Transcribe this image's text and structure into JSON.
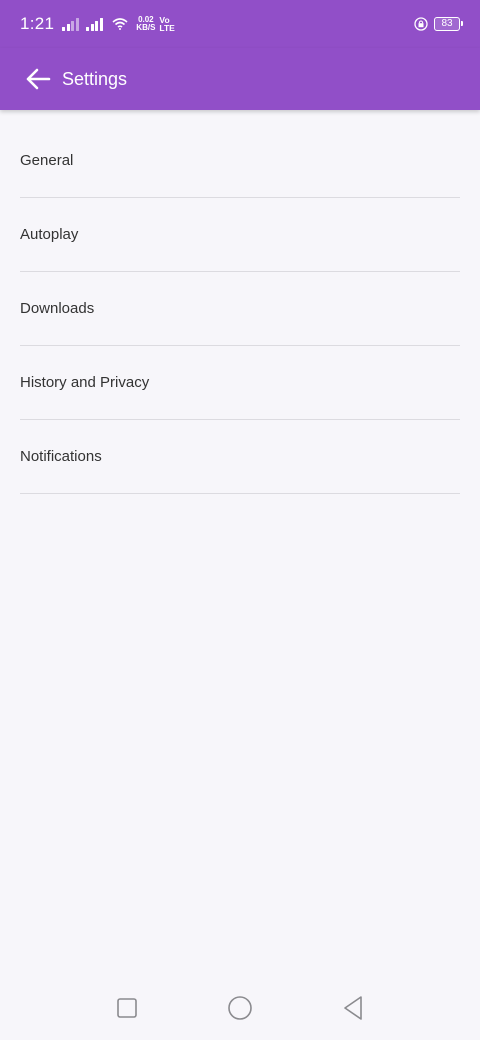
{
  "status_bar": {
    "time": "1:21",
    "speed_value": "0.02",
    "speed_unit": "KB/S",
    "volte_top": "Vo",
    "volte_bottom": "LTE",
    "battery": "83",
    "icons": [
      "signal-icon",
      "signal-icon",
      "wifi-icon",
      "lock-rotation-icon",
      "battery-icon"
    ]
  },
  "app_bar": {
    "title": "Settings",
    "back_icon": "arrow-left-icon",
    "color": "#914fc8"
  },
  "settings": {
    "items": [
      {
        "label": "General"
      },
      {
        "label": "Autoplay"
      },
      {
        "label": "Downloads"
      },
      {
        "label": "History and Privacy"
      },
      {
        "label": "Notifications"
      }
    ]
  },
  "nav_bar": {
    "icons": [
      "recents-square-icon",
      "home-circle-icon",
      "back-triangle-icon"
    ]
  }
}
